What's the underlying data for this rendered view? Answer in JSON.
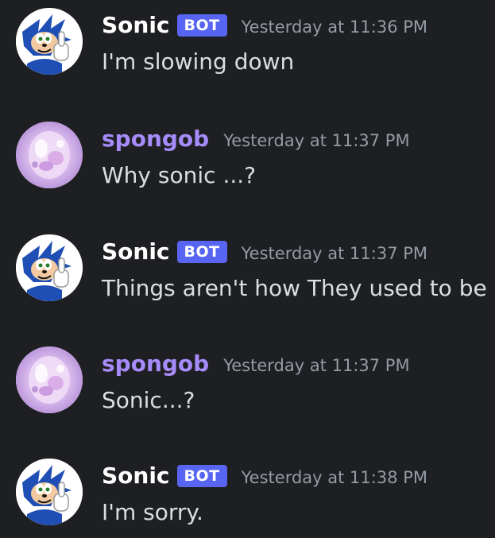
{
  "theme": {
    "background": "#1e1f22",
    "bot_name_color": "#ffffff",
    "user_name_color": "#a78bfa",
    "bot_tag_color": "#5865f2",
    "timestamp_color": "#949ba4",
    "message_text_color": "#dbdee1"
  },
  "messages": [
    {
      "author": "Sonic",
      "is_bot": true,
      "bot_tag": "BOT",
      "avatar_icon": "sonic-avatar-icon",
      "timestamp": "Yesterday at 11:36 PM",
      "content": "I'm slowing down"
    },
    {
      "author": "spongob",
      "is_bot": false,
      "avatar_icon": "spongob-avatar-icon",
      "timestamp": "Yesterday at 11:37 PM",
      "content": "Why sonic ...?"
    },
    {
      "author": "Sonic",
      "is_bot": true,
      "bot_tag": "BOT",
      "avatar_icon": "sonic-avatar-icon",
      "timestamp": "Yesterday at 11:37 PM",
      "content": "Things aren't how They used to be"
    },
    {
      "author": "spongob",
      "is_bot": false,
      "avatar_icon": "spongob-avatar-icon",
      "timestamp": "Yesterday at 11:37 PM",
      "content": "Sonic...?"
    },
    {
      "author": "Sonic",
      "is_bot": true,
      "bot_tag": "BOT",
      "avatar_icon": "sonic-avatar-icon",
      "timestamp": "Yesterday at 11:38 PM",
      "content": "I'm sorry."
    }
  ]
}
